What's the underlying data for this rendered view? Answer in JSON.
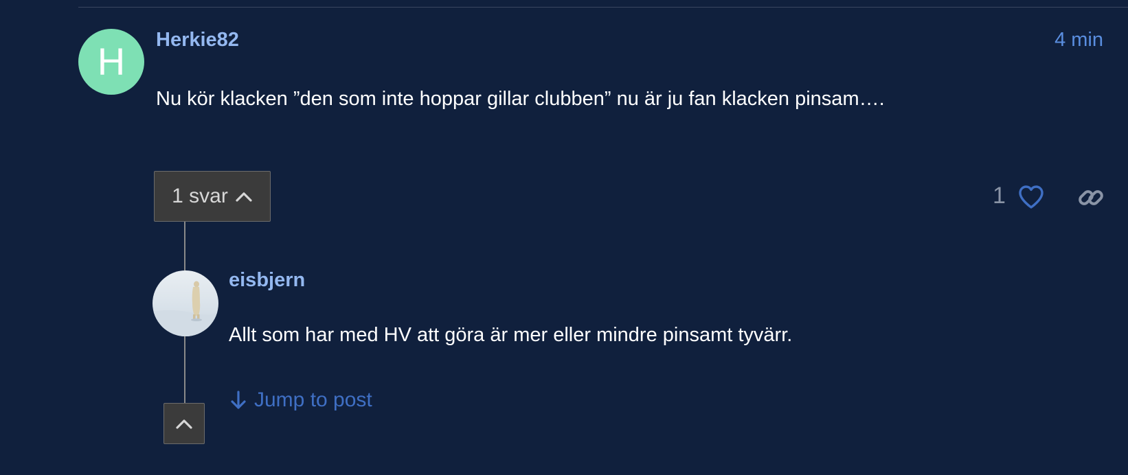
{
  "colors": {
    "background": "#10203d",
    "avatar_green": "#7ee0b4",
    "username": "#94b8f0",
    "link_blue": "#3f6fc4"
  },
  "post": {
    "avatar_letter": "H",
    "username": "Herkie82",
    "time": "4 min",
    "body": "Nu kör klacken ”den som inte hoppar gillar clubben” nu är ju fan klacken pinsam….",
    "replies_label": "1 svar",
    "like_count": "1",
    "icons": {
      "replies_toggle": "chevron-up-icon",
      "like": "heart-icon",
      "share": "link-icon"
    }
  },
  "reply": {
    "username": "eisbjern",
    "body": "Allt som har med HV att göra är mer eller mindre pinsamt tyvärr.",
    "jump_label": "Jump to post",
    "icons": {
      "jump": "arrow-down-icon",
      "collapse": "chevron-up-icon",
      "avatar": "polar-bear-avatar"
    }
  }
}
